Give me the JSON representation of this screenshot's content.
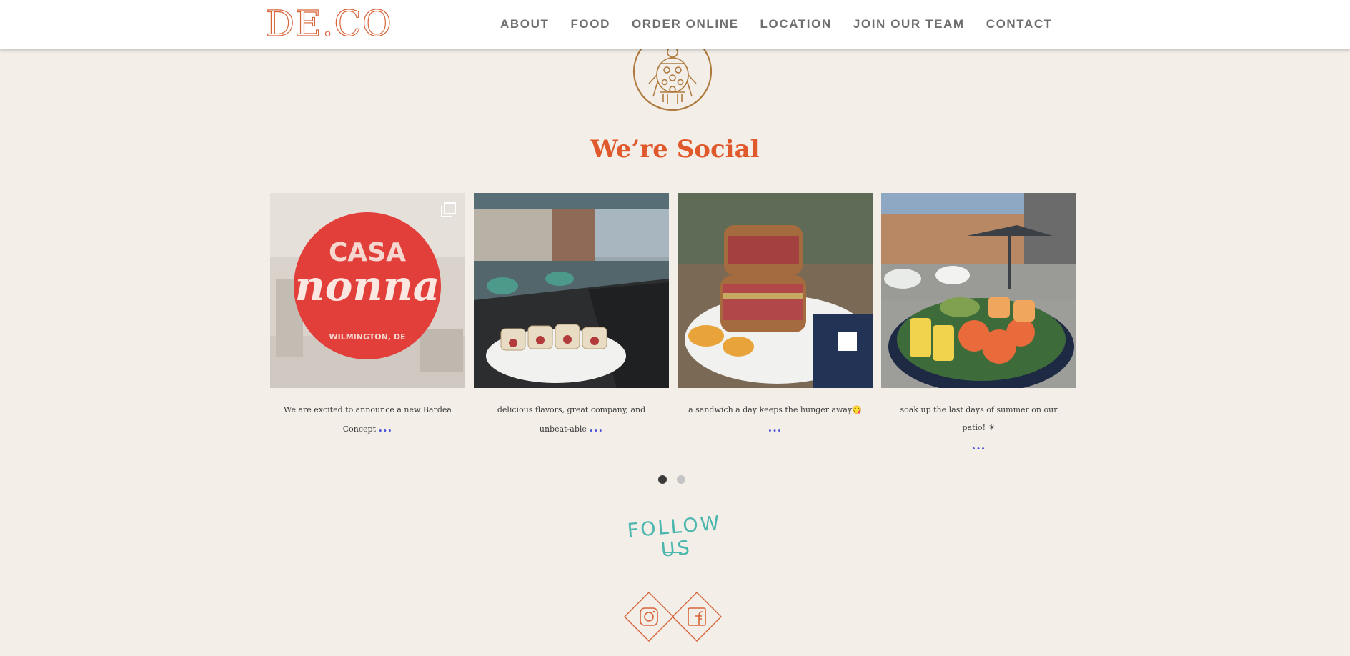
{
  "header": {
    "logo": "DE.CO",
    "nav": [
      "ABOUT",
      "FOOD",
      "ORDER ONLINE",
      "LOCATION",
      "JOIN OUR TEAM",
      "CONTACT"
    ]
  },
  "social_section": {
    "title": "We’re Social",
    "posts": [
      {
        "caption": "We are excited to announce a new Bardea Concept",
        "more": "...",
        "image": "casa-nonna-sign",
        "sign_top": "CASA",
        "sign_main": "nonna",
        "sign_bottom": "WILMINGTON, DE",
        "multi": true
      },
      {
        "caption": "delicious flavors, great company, and unbeat-able",
        "more": "...",
        "image": "sushi-roll-patio",
        "multi": false
      },
      {
        "caption": "a sandwich a day keeps the hunger away😋",
        "more": "...",
        "image": "sandwich-and-chips",
        "multi": false
      },
      {
        "caption": "soak up the last days of summer on our patio! ☀",
        "more": "...",
        "image": "poke-bowl-patio",
        "multi": false
      }
    ],
    "pagination": {
      "pages": 2,
      "active": 1
    }
  },
  "follow": {
    "label": "FOLLOW US",
    "icons": [
      "instagram-icon",
      "facebook-icon"
    ]
  },
  "colors": {
    "background": "#f3eee8",
    "accent": "#e0592c",
    "logo": "#d8653a",
    "emblem": "#b07a3e",
    "teal": "#4bb7ae",
    "nav": "#6e6e6e",
    "more_link": "#4b56d8"
  }
}
